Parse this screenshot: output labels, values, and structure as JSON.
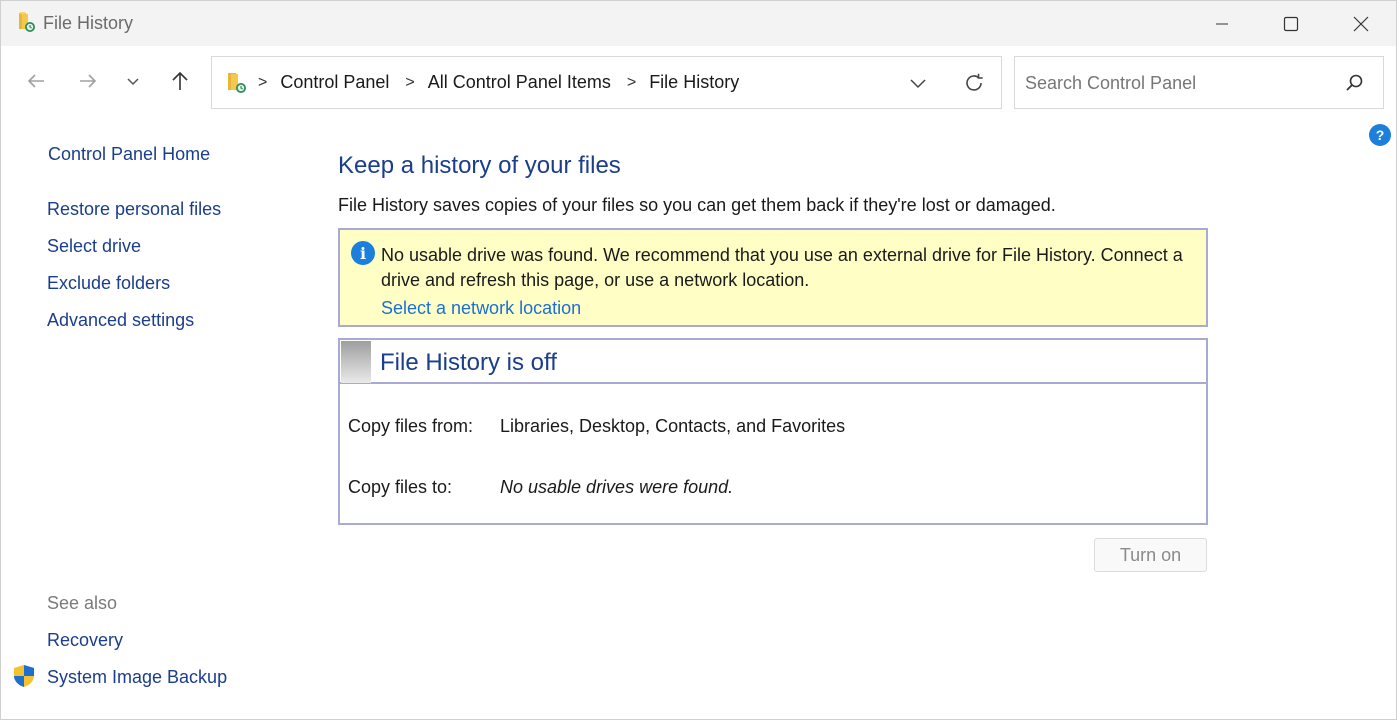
{
  "window": {
    "title": "File History"
  },
  "titlebar": {
    "minimize_icon": "minimize-icon",
    "maximize_icon": "maximize-icon",
    "close_icon": "close-icon"
  },
  "nav": {
    "back_icon": "arrow-left-icon",
    "forward_icon": "arrow-right-icon",
    "recent_icon": "chevron-down-icon",
    "up_icon": "arrow-up-icon"
  },
  "address": {
    "crumbs": [
      "Control Panel",
      "All Control Panel Items",
      "File History"
    ],
    "separator": ">"
  },
  "search": {
    "placeholder": "Search Control Panel"
  },
  "help": {
    "label": "?"
  },
  "sidebar": {
    "home": "Control Panel Home",
    "items": [
      "Restore personal files",
      "Select drive",
      "Exclude folders",
      "Advanced settings"
    ],
    "see_also_heading": "See also",
    "see_also": [
      "Recovery",
      "System Image Backup"
    ]
  },
  "main": {
    "title": "Keep a history of your files",
    "description": "File History saves copies of your files so you can get them back if they're lost or damaged.",
    "info": {
      "icon": "i",
      "message": "No usable drive was found. We recommend that you use an external drive for File History. Connect a drive and refresh this page, or use a network location.",
      "link": "Select a network location"
    },
    "status": {
      "title": "File History is off",
      "copy_from_label": "Copy files from:",
      "copy_from_value": "Libraries, Desktop, Contacts, and Favorites",
      "copy_to_label": "Copy files to:",
      "copy_to_value": "No usable drives were found."
    },
    "turn_on_label": "Turn on"
  },
  "colors": {
    "link": "#1a3e8c",
    "accent_link": "#1a6fd6",
    "info_bg": "#ffffc5",
    "border": "#a9a9d6"
  }
}
